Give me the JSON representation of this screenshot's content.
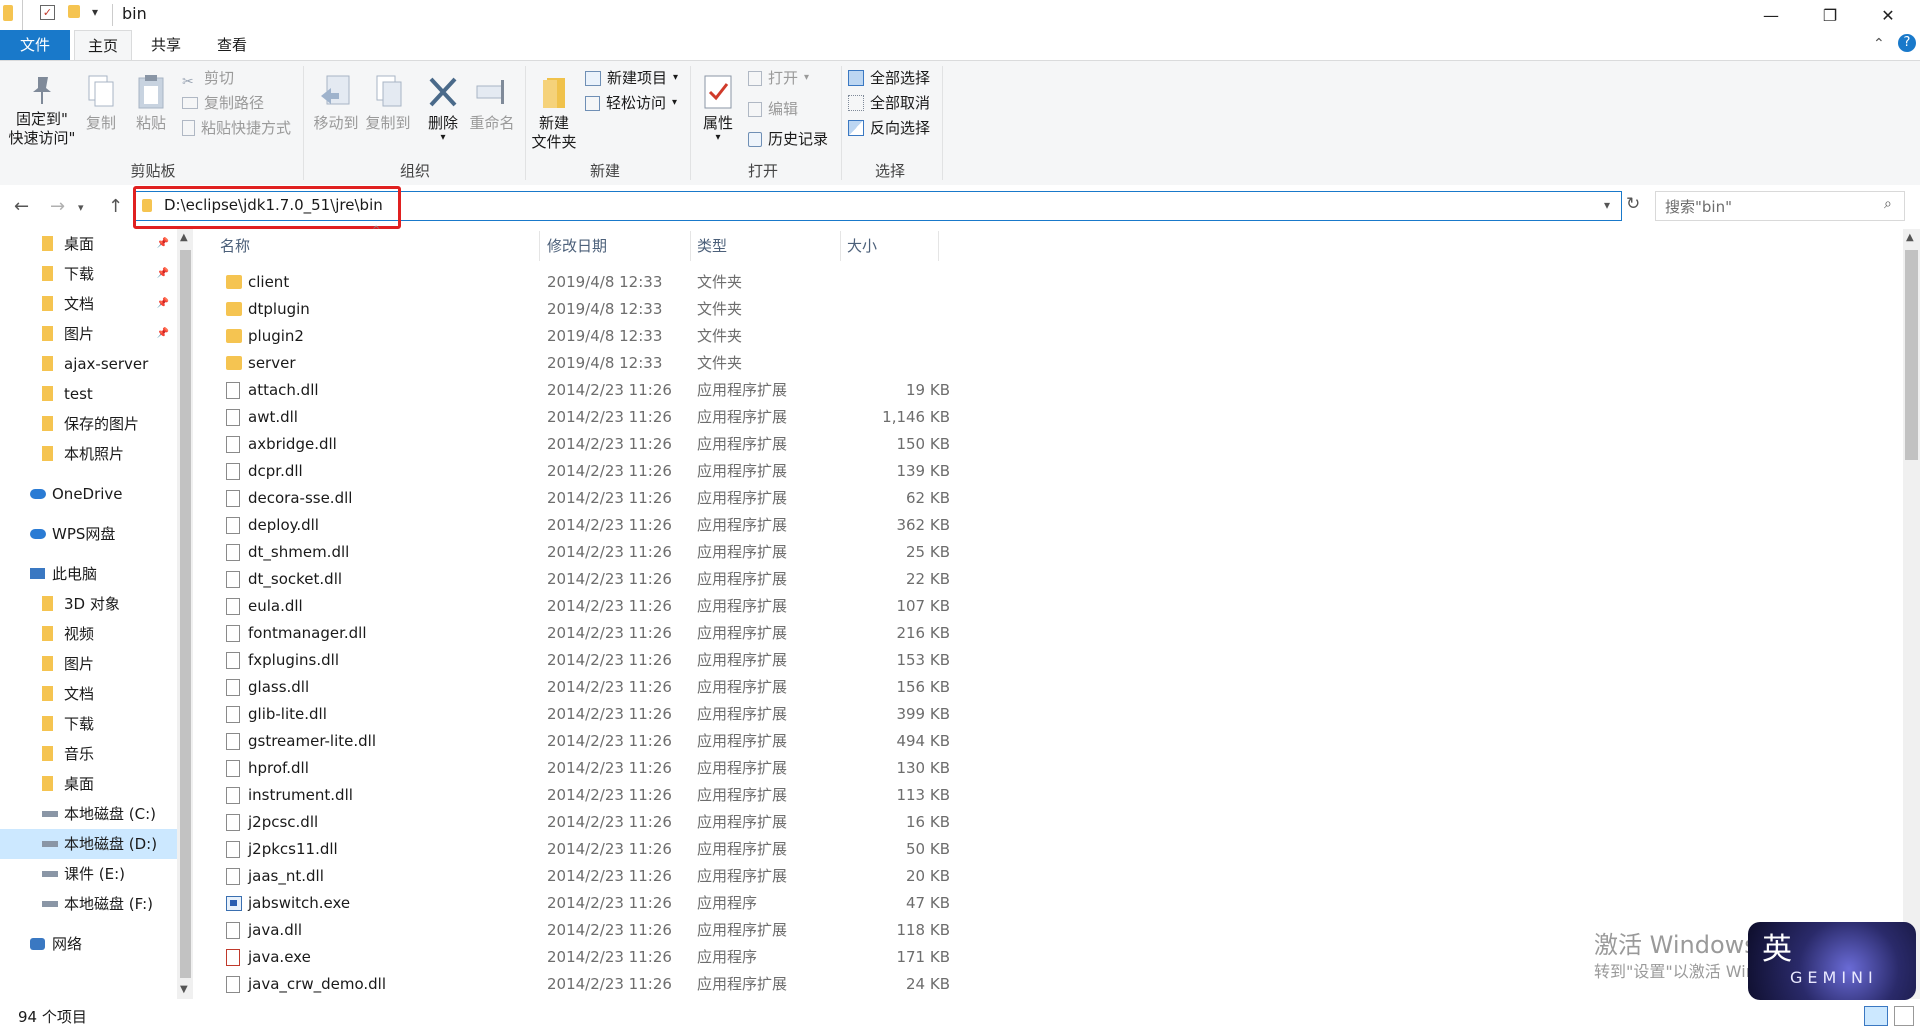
{
  "window": {
    "title": "bin",
    "controls": {
      "minimize": "—",
      "maximize": "❐",
      "close": "✕"
    }
  },
  "ribbon_tabs": [
    "文件",
    "主页",
    "共享",
    "查看"
  ],
  "ribbon": {
    "clipboard": {
      "pin": "固定到\"\n快速访问\"",
      "pin_line1": "固定到\"",
      "pin_line2": "快速访问\"",
      "copy": "复制",
      "paste": "粘贴",
      "cut": "剪切",
      "copy_path": "复制路径",
      "paste_shortcut": "粘贴快捷方式",
      "label": "剪贴板"
    },
    "organize": {
      "move_to": "移动到",
      "copy_to": "复制到",
      "delete": "删除",
      "rename": "重命名",
      "label": "组织"
    },
    "new": {
      "new_folder_line1": "新建",
      "new_folder_line2": "文件夹",
      "new_item": "新建项目",
      "easy_access": "轻松访问",
      "label": "新建"
    },
    "open": {
      "properties": "属性",
      "open": "打开",
      "edit": "编辑",
      "history": "历史记录",
      "label": "打开"
    },
    "select": {
      "select_all": "全部选择",
      "select_none": "全部取消",
      "invert": "反向选择",
      "label": "选择"
    }
  },
  "address": {
    "path": "D:\\eclipse\\jdk1.7.0_51\\jre\\bin",
    "search_placeholder": "搜索\"bin\""
  },
  "nav_pane": [
    {
      "label": "桌面",
      "pinned": true,
      "indent": 1
    },
    {
      "label": "下载",
      "pinned": true,
      "indent": 1
    },
    {
      "label": "文档",
      "pinned": true,
      "indent": 1
    },
    {
      "label": "图片",
      "pinned": true,
      "indent": 1
    },
    {
      "label": "ajax-server",
      "pinned": false,
      "indent": 1
    },
    {
      "label": "test",
      "pinned": false,
      "indent": 1
    },
    {
      "label": "保存的图片",
      "pinned": false,
      "indent": 1
    },
    {
      "label": "本机照片",
      "pinned": false,
      "indent": 1
    },
    {
      "label": "OneDrive",
      "pinned": false,
      "indent": 0
    },
    {
      "label": "WPS网盘",
      "pinned": false,
      "indent": 0
    },
    {
      "label": "此电脑",
      "pinned": false,
      "indent": 0
    },
    {
      "label": "3D 对象",
      "pinned": false,
      "indent": 1
    },
    {
      "label": "视频",
      "pinned": false,
      "indent": 1
    },
    {
      "label": "图片",
      "pinned": false,
      "indent": 1
    },
    {
      "label": "文档",
      "pinned": false,
      "indent": 1
    },
    {
      "label": "下载",
      "pinned": false,
      "indent": 1
    },
    {
      "label": "音乐",
      "pinned": false,
      "indent": 1
    },
    {
      "label": "桌面",
      "pinned": false,
      "indent": 1
    },
    {
      "label": "本地磁盘 (C:)",
      "pinned": false,
      "indent": 1
    },
    {
      "label": "本地磁盘 (D:)",
      "pinned": false,
      "indent": 1,
      "selected": true
    },
    {
      "label": "课件 (E:)",
      "pinned": false,
      "indent": 1
    },
    {
      "label": "本地磁盘 (F:)",
      "pinned": false,
      "indent": 1
    },
    {
      "label": "网络",
      "pinned": false,
      "indent": 0
    }
  ],
  "columns": {
    "name": "名称",
    "date": "修改日期",
    "type": "类型",
    "size": "大小"
  },
  "files": [
    {
      "name": "client",
      "date": "2019/4/8 12:33",
      "type": "文件夹",
      "size": "",
      "kind": "folder"
    },
    {
      "name": "dtplugin",
      "date": "2019/4/8 12:33",
      "type": "文件夹",
      "size": "",
      "kind": "folder"
    },
    {
      "name": "plugin2",
      "date": "2019/4/8 12:33",
      "type": "文件夹",
      "size": "",
      "kind": "folder"
    },
    {
      "name": "server",
      "date": "2019/4/8 12:33",
      "type": "文件夹",
      "size": "",
      "kind": "folder"
    },
    {
      "name": "attach.dll",
      "date": "2014/2/23 11:26",
      "type": "应用程序扩展",
      "size": "19 KB",
      "kind": "dll"
    },
    {
      "name": "awt.dll",
      "date": "2014/2/23 11:26",
      "type": "应用程序扩展",
      "size": "1,146 KB",
      "kind": "dll"
    },
    {
      "name": "axbridge.dll",
      "date": "2014/2/23 11:26",
      "type": "应用程序扩展",
      "size": "150 KB",
      "kind": "dll"
    },
    {
      "name": "dcpr.dll",
      "date": "2014/2/23 11:26",
      "type": "应用程序扩展",
      "size": "139 KB",
      "kind": "dll"
    },
    {
      "name": "decora-sse.dll",
      "date": "2014/2/23 11:26",
      "type": "应用程序扩展",
      "size": "62 KB",
      "kind": "dll"
    },
    {
      "name": "deploy.dll",
      "date": "2014/2/23 11:26",
      "type": "应用程序扩展",
      "size": "362 KB",
      "kind": "dll"
    },
    {
      "name": "dt_shmem.dll",
      "date": "2014/2/23 11:26",
      "type": "应用程序扩展",
      "size": "25 KB",
      "kind": "dll"
    },
    {
      "name": "dt_socket.dll",
      "date": "2014/2/23 11:26",
      "type": "应用程序扩展",
      "size": "22 KB",
      "kind": "dll"
    },
    {
      "name": "eula.dll",
      "date": "2014/2/23 11:26",
      "type": "应用程序扩展",
      "size": "107 KB",
      "kind": "dll"
    },
    {
      "name": "fontmanager.dll",
      "date": "2014/2/23 11:26",
      "type": "应用程序扩展",
      "size": "216 KB",
      "kind": "dll"
    },
    {
      "name": "fxplugins.dll",
      "date": "2014/2/23 11:26",
      "type": "应用程序扩展",
      "size": "153 KB",
      "kind": "dll"
    },
    {
      "name": "glass.dll",
      "date": "2014/2/23 11:26",
      "type": "应用程序扩展",
      "size": "156 KB",
      "kind": "dll"
    },
    {
      "name": "glib-lite.dll",
      "date": "2014/2/23 11:26",
      "type": "应用程序扩展",
      "size": "399 KB",
      "kind": "dll"
    },
    {
      "name": "gstreamer-lite.dll",
      "date": "2014/2/23 11:26",
      "type": "应用程序扩展",
      "size": "494 KB",
      "kind": "dll"
    },
    {
      "name": "hprof.dll",
      "date": "2014/2/23 11:26",
      "type": "应用程序扩展",
      "size": "130 KB",
      "kind": "dll"
    },
    {
      "name": "instrument.dll",
      "date": "2014/2/23 11:26",
      "type": "应用程序扩展",
      "size": "113 KB",
      "kind": "dll"
    },
    {
      "name": "j2pcsc.dll",
      "date": "2014/2/23 11:26",
      "type": "应用程序扩展",
      "size": "16 KB",
      "kind": "dll"
    },
    {
      "name": "j2pkcs11.dll",
      "date": "2014/2/23 11:26",
      "type": "应用程序扩展",
      "size": "50 KB",
      "kind": "dll"
    },
    {
      "name": "jaas_nt.dll",
      "date": "2014/2/23 11:26",
      "type": "应用程序扩展",
      "size": "20 KB",
      "kind": "dll"
    },
    {
      "name": "jabswitch.exe",
      "date": "2014/2/23 11:26",
      "type": "应用程序",
      "size": "47 KB",
      "kind": "exe"
    },
    {
      "name": "java.dll",
      "date": "2014/2/23 11:26",
      "type": "应用程序扩展",
      "size": "118 KB",
      "kind": "dll"
    },
    {
      "name": "java.exe",
      "date": "2014/2/23 11:26",
      "type": "应用程序",
      "size": "171 KB",
      "kind": "java"
    },
    {
      "name": "java_crw_demo.dll",
      "date": "2014/2/23 11:26",
      "type": "应用程序扩展",
      "size": "24 KB",
      "kind": "dll"
    }
  ],
  "status": {
    "count": "94 个项目"
  },
  "watermark": {
    "line1": "激活 Windows",
    "line2": "转到\"设置\"以激活 Windows。"
  },
  "ime": {
    "char": "英",
    "brand": "GEMINI"
  },
  "colors": {
    "accent": "#1979ca",
    "folder": "#f5c451",
    "highlight": "#e02020",
    "selected": "#cce8ff"
  }
}
